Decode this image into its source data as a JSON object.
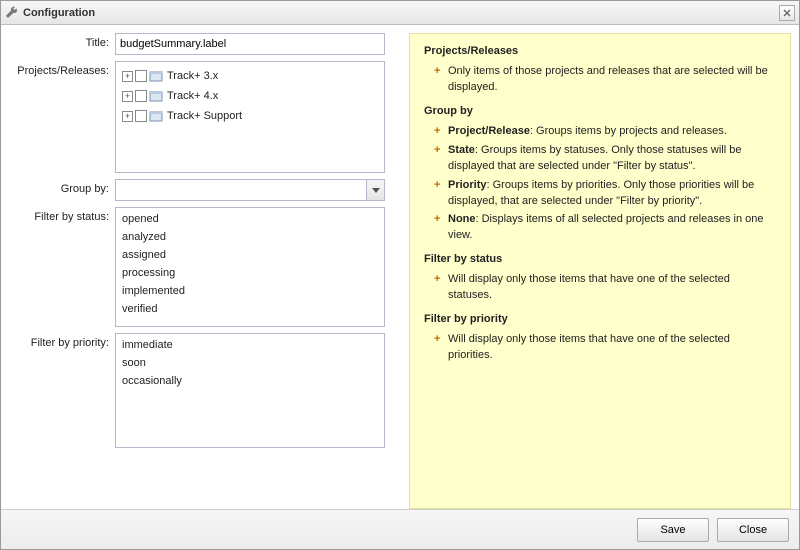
{
  "window": {
    "title": "Configuration"
  },
  "form": {
    "title": {
      "label": "Title:",
      "value": "budgetSummary.label"
    },
    "projects": {
      "label": "Projects/Releases:",
      "nodes": [
        {
          "label": "Track+ 3.x"
        },
        {
          "label": "Track+ 4.x"
        },
        {
          "label": "Track+ Support"
        }
      ]
    },
    "groupby": {
      "label": "Group by:",
      "value": ""
    },
    "filterStatus": {
      "label": "Filter by status:",
      "items": [
        "opened",
        "analyzed",
        "assigned",
        "processing",
        "implemented",
        "verified"
      ]
    },
    "filterPriority": {
      "label": "Filter by priority:",
      "items": [
        "immediate",
        "soon",
        "occasionally"
      ]
    }
  },
  "help": {
    "h_projects": "Projects/Releases",
    "projects_b1": "Only items of those projects and releases that are selected will be displayed.",
    "h_groupby": "Group by",
    "gb1_k": "Project/Release",
    "gb1_t": ": Groups items by projects and releases.",
    "gb2_k": "State",
    "gb2_t": ": Groups items by statuses. Only those statuses will be displayed that are selected under \"Filter by status\".",
    "gb3_k": "Priority",
    "gb3_t": ": Groups items by priorities. Only those priorities will be displayed, that are selected under \"Filter by priority\".",
    "gb4_k": "None",
    "gb4_t": ": Displays items of all selected projects and releases in one view.",
    "h_fstatus": "Filter by status",
    "fstatus_b1": "Will display only those items that have one of the selected statuses.",
    "h_fpriority": "Filter by priority",
    "fpriority_b1": "Will display only those items that have one of the selected priorities."
  },
  "footer": {
    "save": "Save",
    "close": "Close"
  }
}
